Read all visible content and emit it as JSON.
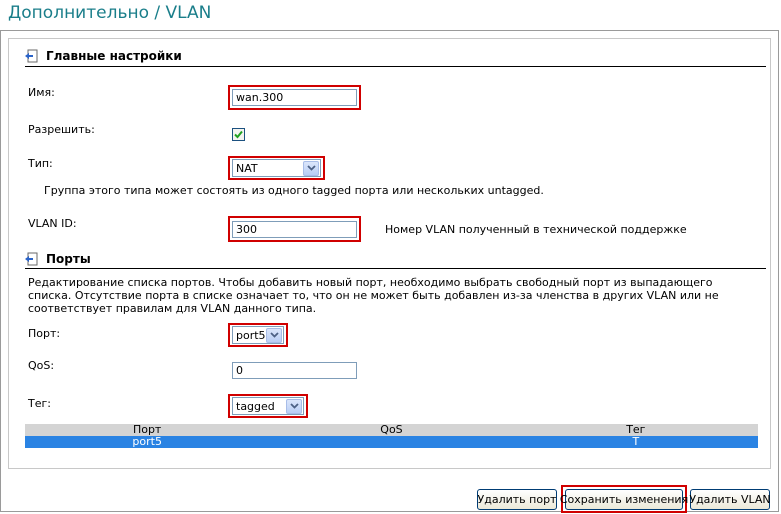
{
  "page": {
    "title": "Дополнительно / VLAN"
  },
  "main_settings": {
    "heading": "Главные настройки",
    "name_label": "Имя:",
    "name_value": "wan.300",
    "enable_label": "Разрешить:",
    "enable_checked": true,
    "type_label": "Тип:",
    "type_value": "NAT",
    "type_hint": "Группа этого типа может состоять из одного tagged порта или нескольких untagged.",
    "vlan_id_label": "VLAN ID:",
    "vlan_id_value": "300",
    "vlan_id_hint": "Номер VLAN полученный в технической поддержке"
  },
  "ports_section": {
    "heading": "Порты",
    "description": "Редактирование списка портов. Чтобы добавить новый порт, необходимо выбрать свободный порт из выпадающего списка. Отсутствие порта в списке означает то, что он не может быть добавлен из-за членства в других VLAN или не соответствует правилам для VLAN данного типа.",
    "port_label": "Порт:",
    "port_value": "port5",
    "qos_label": "QoS:",
    "qos_value": "0",
    "tag_label": "Тег:",
    "tag_value": "tagged",
    "table": {
      "columns": [
        "Порт",
        "QoS",
        "Тег"
      ],
      "rows": [
        {
          "port": "port5",
          "qos": "",
          "tag": "T",
          "selected": true
        }
      ]
    }
  },
  "buttons": {
    "delete_port": "Удалить порт",
    "save_changes": "Сохранить изменения",
    "delete_vlan": "Удалить VLAN"
  },
  "colors": {
    "title": "#1a7e8a",
    "highlight": "#d00000",
    "selected_row": "#2a83e3"
  }
}
